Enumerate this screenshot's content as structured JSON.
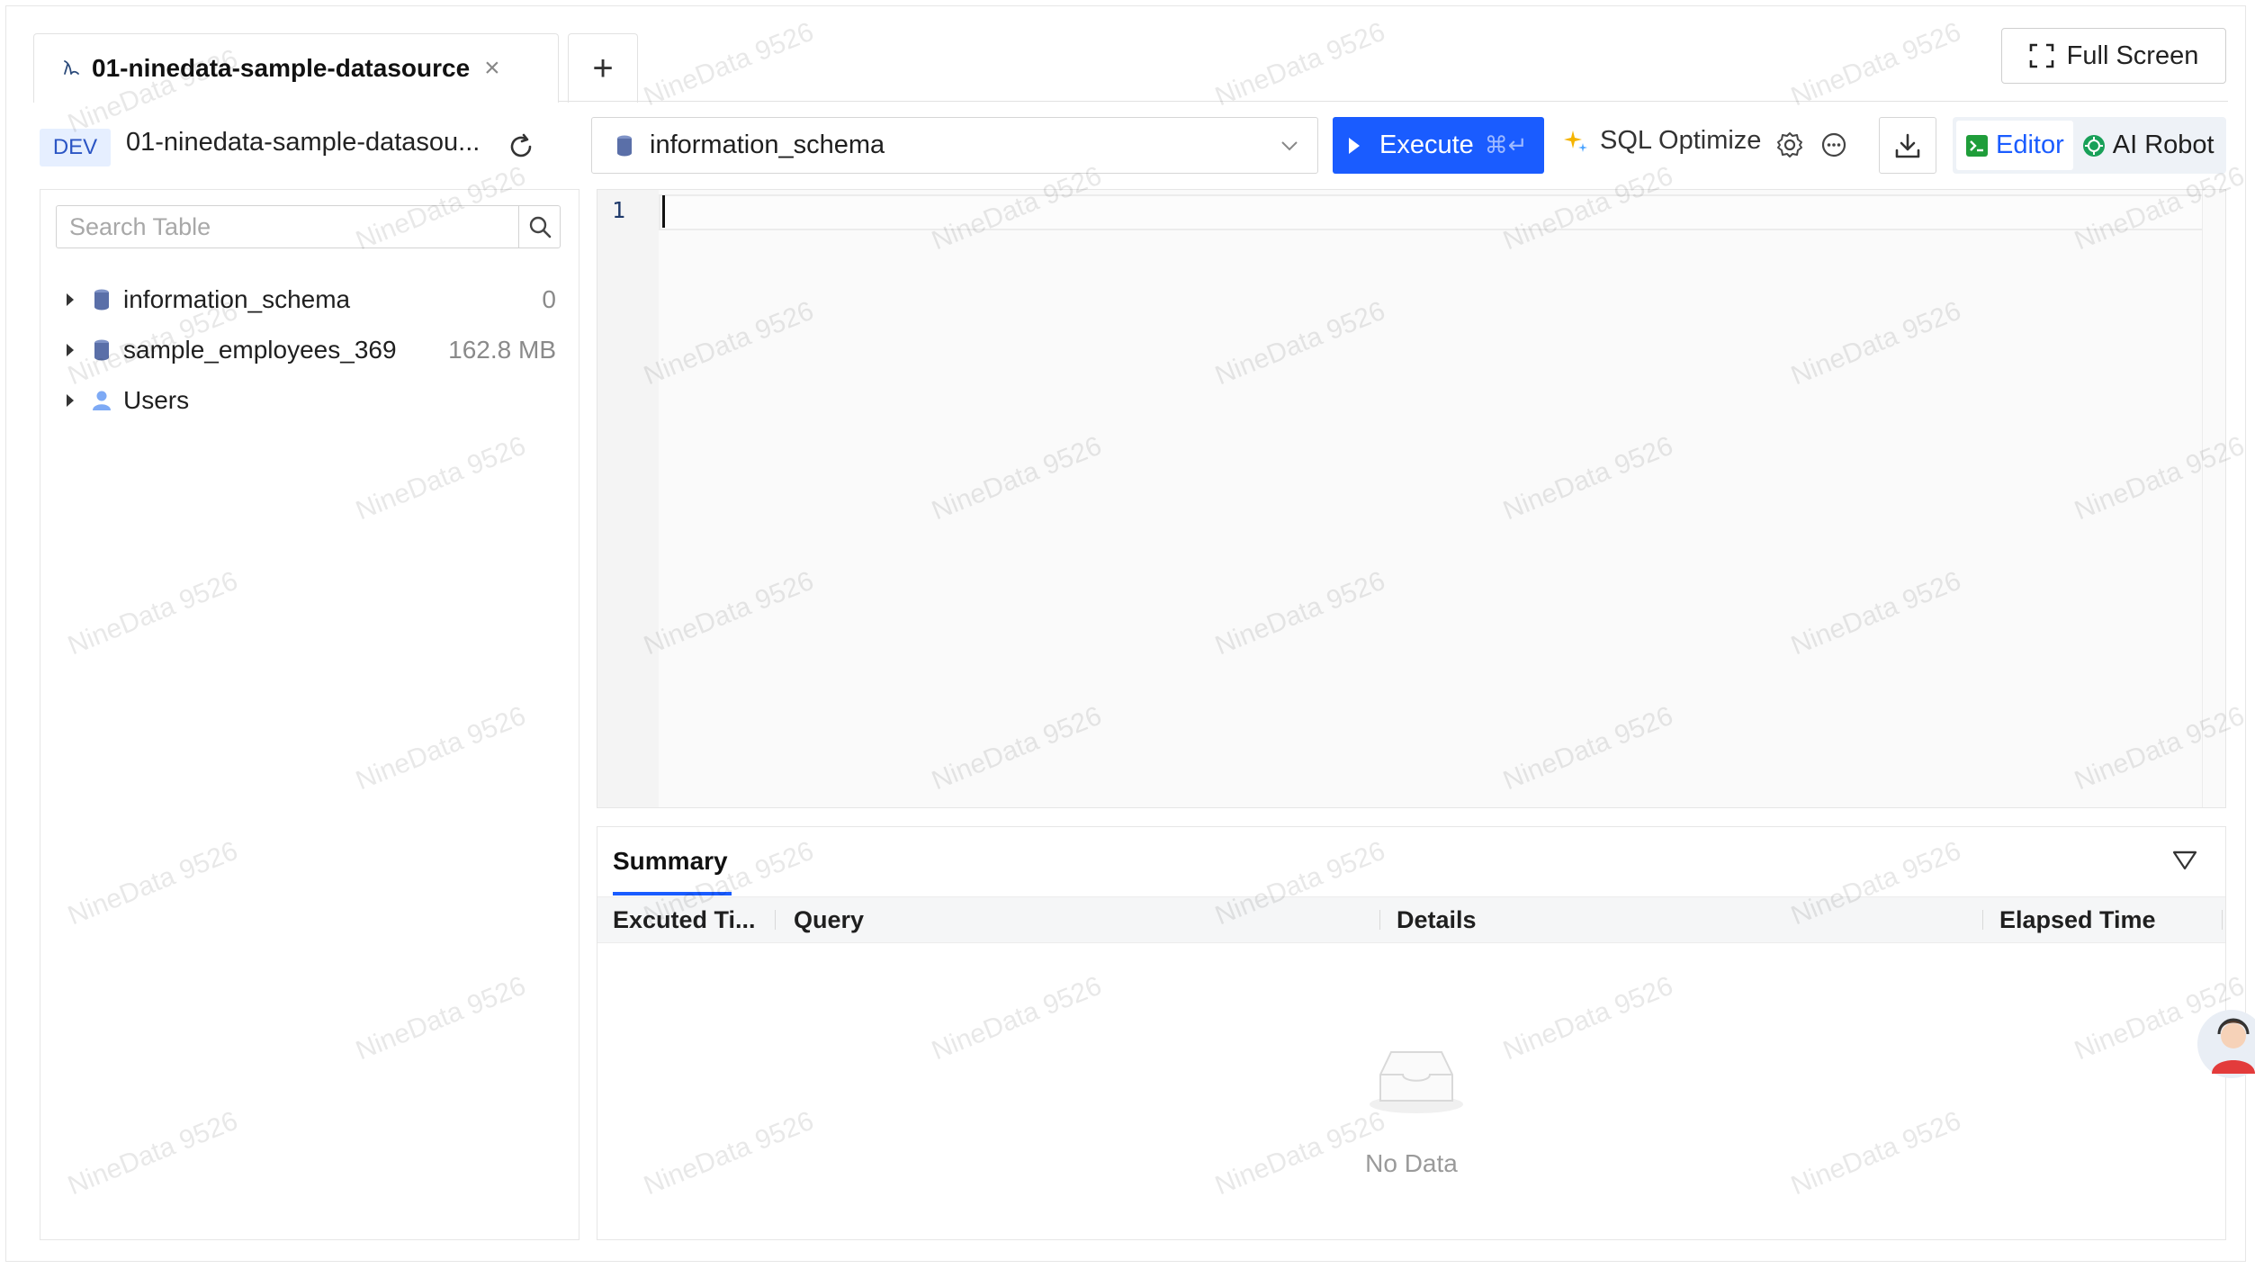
{
  "tabs": {
    "active_label": "01-ninedata-sample-datasource",
    "close_glyph": "×",
    "add_glyph": "+"
  },
  "fullscreen": {
    "label": "Full Screen"
  },
  "datasource": {
    "env": "DEV",
    "name": "01-ninedata-sample-datasou..."
  },
  "sidebar": {
    "search_placeholder": "Search Table",
    "tree": [
      {
        "label": "information_schema",
        "meta": "0",
        "icon": "database-icon"
      },
      {
        "label": "sample_employees_369",
        "meta": "162.8 MB",
        "icon": "database-icon"
      },
      {
        "label": "Users",
        "meta": "",
        "icon": "user-icon"
      }
    ]
  },
  "toolbar": {
    "database_value": "information_schema",
    "execute_label": "Execute",
    "execute_shortcut": "⌘↵",
    "sql_optimize_label": "SQL Optimize",
    "mode_editor": "Editor",
    "mode_ai": "AI Robot"
  },
  "editor": {
    "line_numbers": [
      "1"
    ]
  },
  "results": {
    "tab_label": "Summary",
    "columns": [
      "Excuted Ti...",
      "Query",
      "Details",
      "Elapsed Time"
    ],
    "empty_text": "No Data"
  },
  "watermark": {
    "text": "NineData 9526"
  },
  "colors": {
    "accent": "#1a5cff",
    "env_badge_bg": "#e6efff",
    "env_badge_text": "#2b55c4"
  }
}
